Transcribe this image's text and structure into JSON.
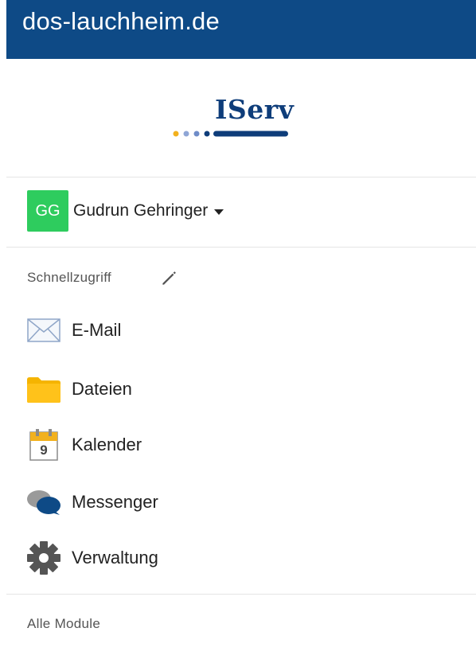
{
  "header": {
    "title": "dos-lauchheim.de"
  },
  "logo": {
    "text": "IServ"
  },
  "user": {
    "initials": "GG",
    "name": "Gudrun Gehringer"
  },
  "quick_access": {
    "label": "Schnellzugriff",
    "items": [
      {
        "label": "E-Mail",
        "icon": "mail-icon"
      },
      {
        "label": "Dateien",
        "icon": "folder-icon"
      },
      {
        "label": "Kalender",
        "icon": "calendar-icon",
        "calendar_day": "9"
      },
      {
        "label": "Messenger",
        "icon": "chat-icon"
      },
      {
        "label": "Verwaltung",
        "icon": "gear-icon"
      }
    ]
  },
  "all_modules": {
    "label": "Alle Module"
  },
  "colors": {
    "header_bg": "#0e4a86",
    "avatar_bg": "#2ecc5e",
    "folder": "#f5b400",
    "logo_blue": "#0e3d7a"
  }
}
